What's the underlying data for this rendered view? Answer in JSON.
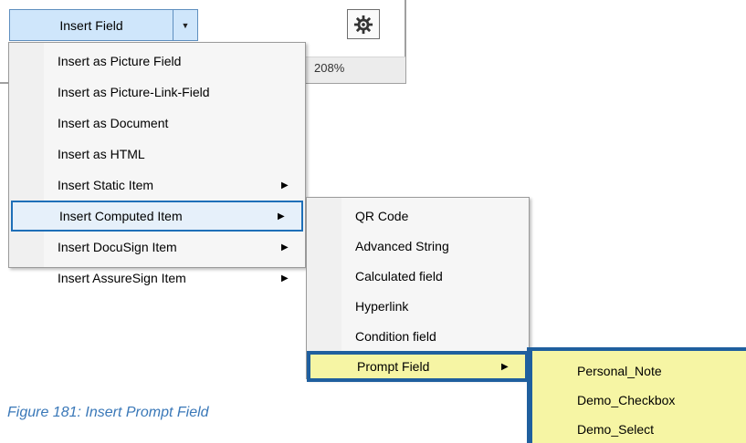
{
  "split_button": {
    "label": "Insert Field",
    "dropdown_glyph": "▼"
  },
  "toolbar": {
    "settings_icon": "gear-icon"
  },
  "status_bar": {
    "zoom_minus": "-",
    "zoom_plus": "+",
    "zoom_level": "208%"
  },
  "insert_menu": {
    "items": [
      {
        "label": "Insert as Picture Field",
        "has_submenu": false
      },
      {
        "label": "Insert as Picture-Link-Field",
        "has_submenu": false
      },
      {
        "label": "Insert as Document",
        "has_submenu": false
      },
      {
        "label": "Insert as HTML",
        "has_submenu": false
      },
      {
        "label": "Insert Static Item",
        "has_submenu": true
      },
      {
        "label": "Insert Computed Item",
        "has_submenu": true,
        "selected": true
      },
      {
        "label": "Insert DocuSign Item",
        "has_submenu": true
      },
      {
        "label": "Insert AssureSign Item",
        "has_submenu": true
      }
    ],
    "submenu_arrow": "▶"
  },
  "computed_menu": {
    "items": [
      {
        "label": "QR Code",
        "has_submenu": false
      },
      {
        "label": "Advanced String",
        "has_submenu": false
      },
      {
        "label": "Calculated field",
        "has_submenu": false
      },
      {
        "label": "Hyperlink",
        "has_submenu": false
      },
      {
        "label": "Condition field",
        "has_submenu": false
      },
      {
        "label": "Prompt Field",
        "has_submenu": true,
        "selected": true
      }
    ]
  },
  "prompt_menu": {
    "items": [
      {
        "label": "Personal_Note"
      },
      {
        "label": "Demo_Checkbox"
      },
      {
        "label": "Demo_Select"
      }
    ]
  },
  "caption": "Figure 181: Insert Prompt Field",
  "colors": {
    "button_bg": "#cfe6fb",
    "selection_border": "#1e6fb8",
    "highlight_bg": "#f6f5a4",
    "caption": "#3a78b8"
  }
}
